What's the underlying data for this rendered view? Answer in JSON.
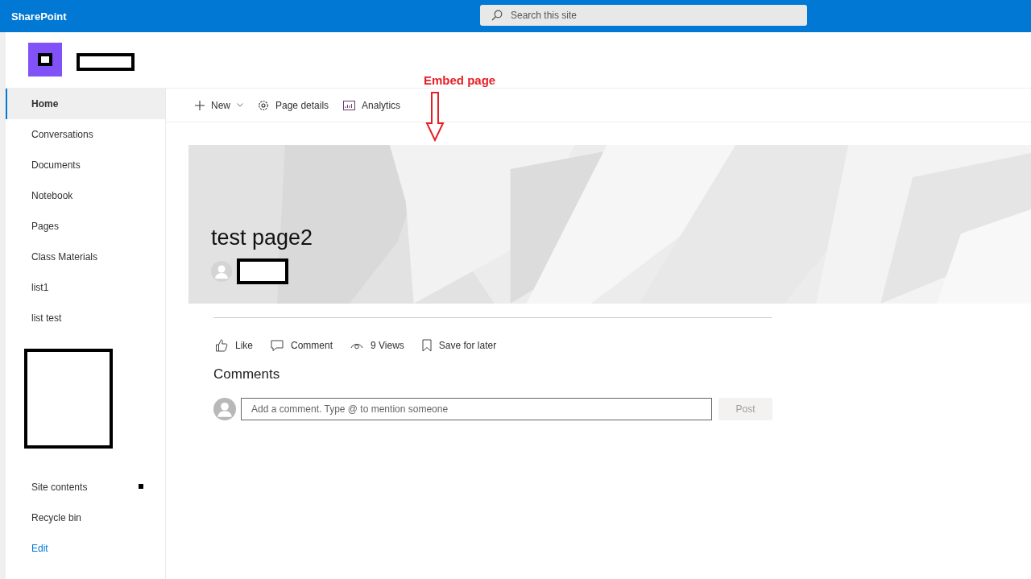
{
  "top_bar": {
    "brand": "SharePoint",
    "search": {
      "placeholder": "Search this site"
    }
  },
  "sidebar": {
    "items": [
      {
        "label": "Home",
        "selected": true
      },
      {
        "label": "Conversations",
        "selected": false
      },
      {
        "label": "Documents",
        "selected": false
      },
      {
        "label": "Notebook",
        "selected": false
      },
      {
        "label": "Pages",
        "selected": false
      },
      {
        "label": "Class Materials",
        "selected": false
      },
      {
        "label": "list1",
        "selected": false
      },
      {
        "label": "list test",
        "selected": false
      }
    ],
    "bottom_items": [
      {
        "label": "Site contents",
        "selected": false
      },
      {
        "label": "Recycle bin",
        "selected": false
      }
    ],
    "edit_link": "Edit"
  },
  "command_bar": [
    {
      "label": "New",
      "kind": "new"
    },
    {
      "label": "Page details",
      "kind": "details"
    },
    {
      "label": "Analytics",
      "kind": "analytics"
    }
  ],
  "annotation": "Embed page",
  "hero": {
    "title": "test page2"
  },
  "actions": [
    {
      "label": "Like",
      "kind": "like"
    },
    {
      "label": "Comment",
      "kind": "comment"
    },
    {
      "label": "9 Views",
      "kind": "views"
    },
    {
      "label": "Save for later",
      "kind": "save"
    }
  ],
  "comments": {
    "heading": "Comments",
    "placeholder": "Add a comment. Type @ to mention someone",
    "post": {
      "label": "Post",
      "disabled": true
    }
  }
}
